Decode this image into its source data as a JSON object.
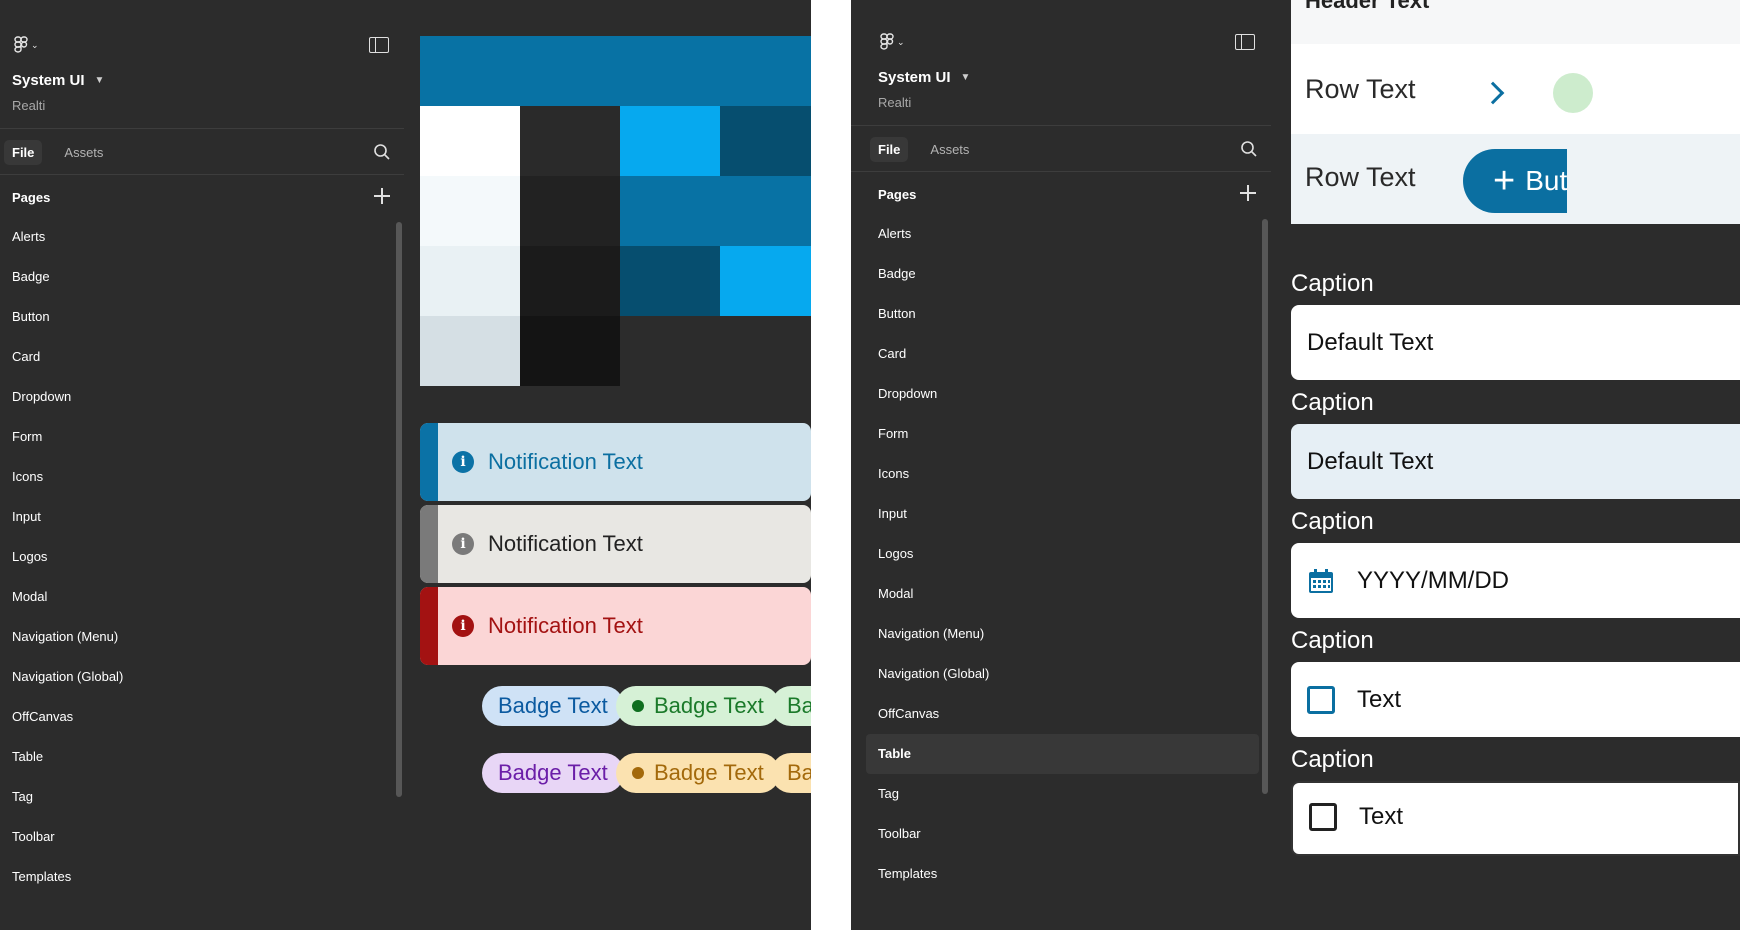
{
  "left_panel": {
    "project": {
      "title": "System UI",
      "team": "Realti"
    },
    "tabs": [
      {
        "label": "File",
        "active": true
      },
      {
        "label": "Assets",
        "active": false
      }
    ],
    "pages_header": "Pages",
    "pages": [
      "Alerts",
      "Badge",
      "Button",
      "Card",
      "Dropdown",
      "Form",
      "Icons",
      "Input",
      "Logos",
      "Modal",
      "Navigation (Menu)",
      "Navigation (Global)",
      "OffCanvas",
      "Table",
      "Tag",
      "Toolbar",
      "Templates"
    ],
    "icons": {
      "logo": "figma-logo-icon",
      "menu_chevron": "chevron-down-icon",
      "sidebar_toggle": "sidebar-toggle-icon",
      "search": "search-icon",
      "add_page": "plus-icon"
    },
    "canvas": {
      "swatches": {
        "header": "#0872a4",
        "columns": [
          [
            "#ffffff",
            "#f4f9fb",
            "#e9f1f4",
            "#d5dfe4"
          ],
          [
            "#2a2a2a",
            "#222222",
            "#1b1b1b",
            "#141414"
          ],
          [
            "#06a9ef",
            "#0872a4",
            "#064e6f"
          ],
          [
            "#064e6f",
            "#0872a4",
            "#06a9ef"
          ]
        ]
      },
      "notifications": [
        {
          "text": "Notification Text",
          "bg": "#cfe2ec",
          "bar": "#0b72a6",
          "color": "#0b6fa1",
          "icon": "info-icon"
        },
        {
          "text": "Notification Text",
          "bg": "#e8e7e3",
          "bar": "#7a7a7a",
          "color": "#222222",
          "icon": "info-icon"
        },
        {
          "text": "Notification Text",
          "bg": "#fbd6d6",
          "bar": "#a31212",
          "color": "#a31212",
          "icon": "info-icon"
        }
      ],
      "badges_row1": [
        {
          "text": "Badge Text",
          "bg": "#cfe2f6",
          "color": "#0b5aa0",
          "dot": null
        },
        {
          "text": "Badge Text",
          "bg": "#d6f1d6",
          "color": "#1b7a2a",
          "dot": "#0f6e1f"
        },
        {
          "text": "Badge Text",
          "bg": "#d6f1d6",
          "color": "#1b7a2a",
          "dot": null
        }
      ],
      "badges_row2": [
        {
          "text": "Badge Text",
          "bg": "#e8d6f6",
          "color": "#6b1ea8",
          "dot": null
        },
        {
          "text": "Badge Text",
          "bg": "#fbe2b0",
          "color": "#a3690b",
          "dot": "#a3690b"
        },
        {
          "text": "Badge Text",
          "bg": "#fbe2b0",
          "color": "#a3690b",
          "dot": null
        }
      ]
    }
  },
  "right_panel": {
    "project": {
      "title": "System UI",
      "team": "Realti"
    },
    "tabs": [
      {
        "label": "File",
        "active": true
      },
      {
        "label": "Assets",
        "active": false
      }
    ],
    "pages_header": "Pages",
    "pages": [
      "Alerts",
      "Badge",
      "Button",
      "Card",
      "Dropdown",
      "Form",
      "Icons",
      "Input",
      "Logos",
      "Modal",
      "Navigation (Menu)",
      "Navigation (Global)",
      "OffCanvas",
      "Table",
      "Tag",
      "Toolbar",
      "Templates"
    ],
    "selected_page": "Table",
    "canvas": {
      "header_text": "Header Text",
      "rows": [
        {
          "text": "Row Text",
          "bg": "#ffffff"
        },
        {
          "text": "Row Text",
          "bg": "#eef3f6",
          "button": "Button"
        }
      ],
      "fields": [
        {
          "caption": "Caption",
          "value": "Default Text",
          "variant": "default"
        },
        {
          "caption": "Caption",
          "value": "Default Text",
          "variant": "alt"
        },
        {
          "caption": "Caption",
          "value": "YYYY/MM/DD",
          "variant": "date",
          "icon": "calendar-icon"
        },
        {
          "caption": "Caption",
          "value": "Text",
          "variant": "checkbox",
          "icon": "checkbox-icon"
        },
        {
          "caption": "Caption",
          "value": "Text",
          "variant": "checkbox-dark",
          "icon": "checkbox-icon"
        }
      ]
    }
  }
}
